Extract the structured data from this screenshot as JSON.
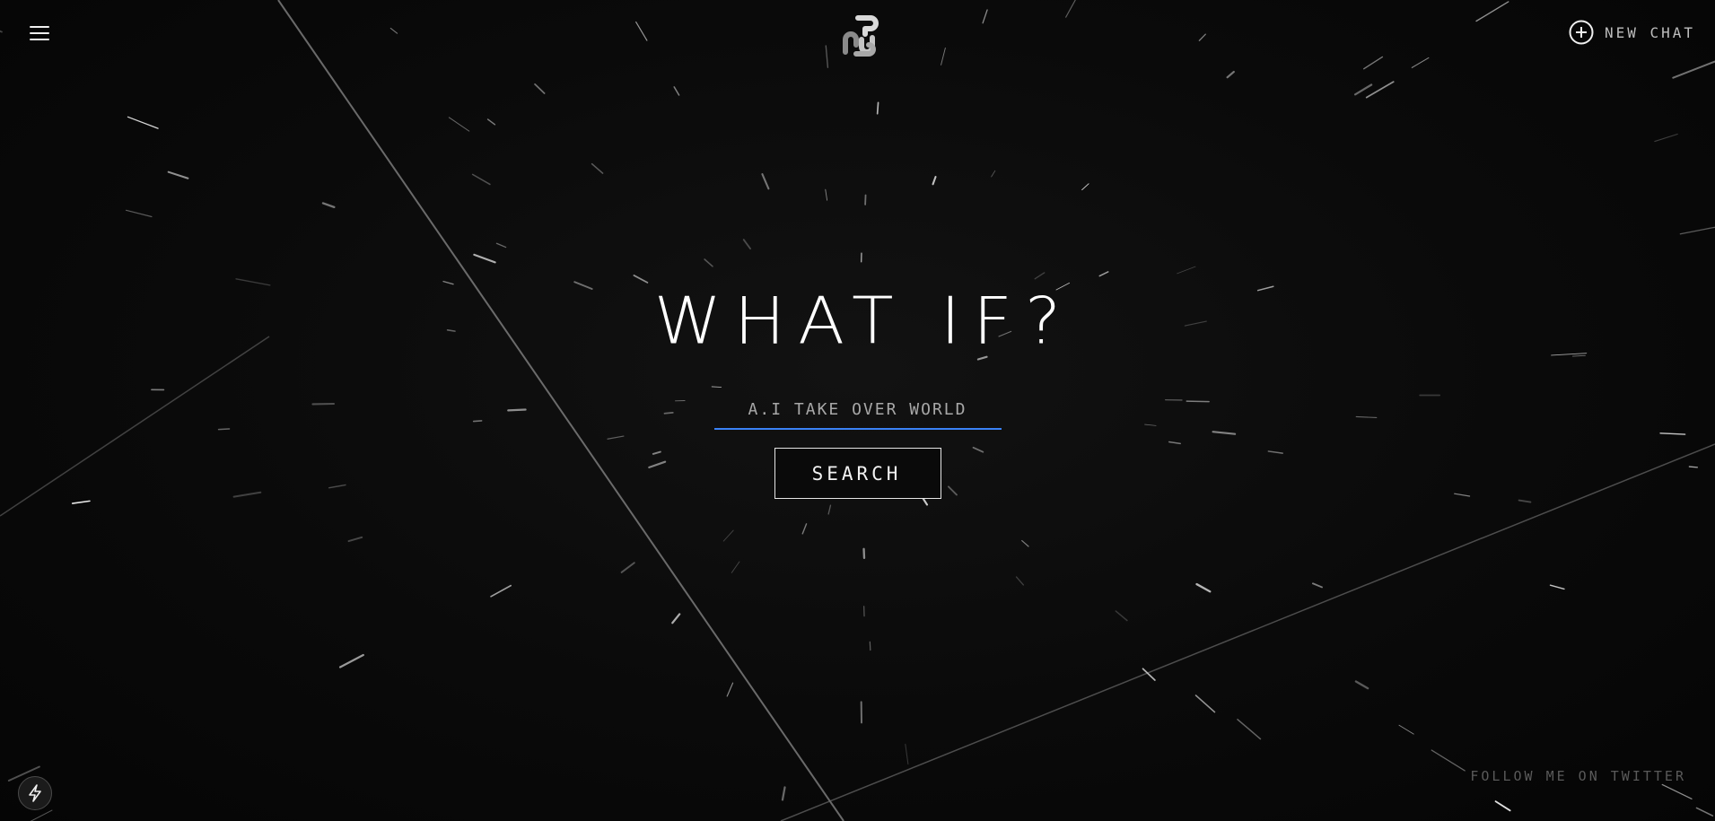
{
  "header": {
    "menu_icon": "hamburger-menu-icon",
    "logo_icon": "stacked-glyph-logo",
    "new_chat_label": "NEW CHAT",
    "new_chat_icon": "plus-circle-icon"
  },
  "main": {
    "headline": "WHAT IF?",
    "query_value": "A.I TAKE OVER WORLD",
    "search_label": "SEARCH"
  },
  "footer": {
    "twitter_link": "FOLLOW ME ON TWITTER",
    "badge_icon": "lightning-bolt-icon"
  },
  "colors": {
    "background": "#070707",
    "input_underline": "#3b82f6",
    "text": "#ffffff"
  }
}
